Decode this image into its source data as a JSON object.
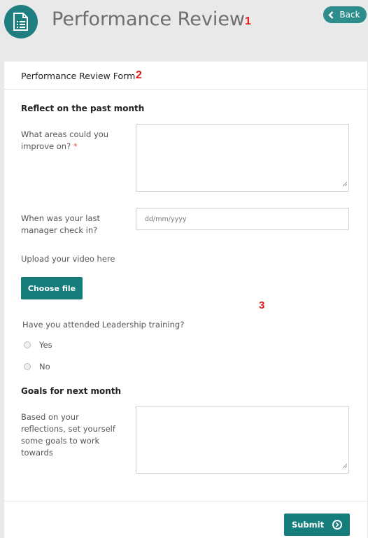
{
  "header": {
    "title": "Performance Review",
    "back_label": "Back",
    "annotation_1": "1"
  },
  "form": {
    "title": "Performance Review Form",
    "annotation_2": "2",
    "annotation_3": "3",
    "section_past": "Reflect on the past month",
    "improve_label": "What areas could you improve on?",
    "improve_required_mark": "*",
    "improve_value": "",
    "checkin_label": "When was your last manager check in?",
    "checkin_placeholder": "dd/mm/yyyy",
    "upload_label": "Upload your video here",
    "choose_file_label": "Choose file",
    "leadership_question": "Have you attended Leadership training?",
    "options": [
      "Yes",
      "No"
    ],
    "section_goals": "Goals for next month",
    "goals_label": "Based on your reflections, set yourself some goals to work towards",
    "goals_value": "",
    "submit_label": "Submit"
  },
  "colors": {
    "accent": "#167d7d",
    "back_button": "#2d8c8c",
    "annotation": "#e01a1a"
  }
}
